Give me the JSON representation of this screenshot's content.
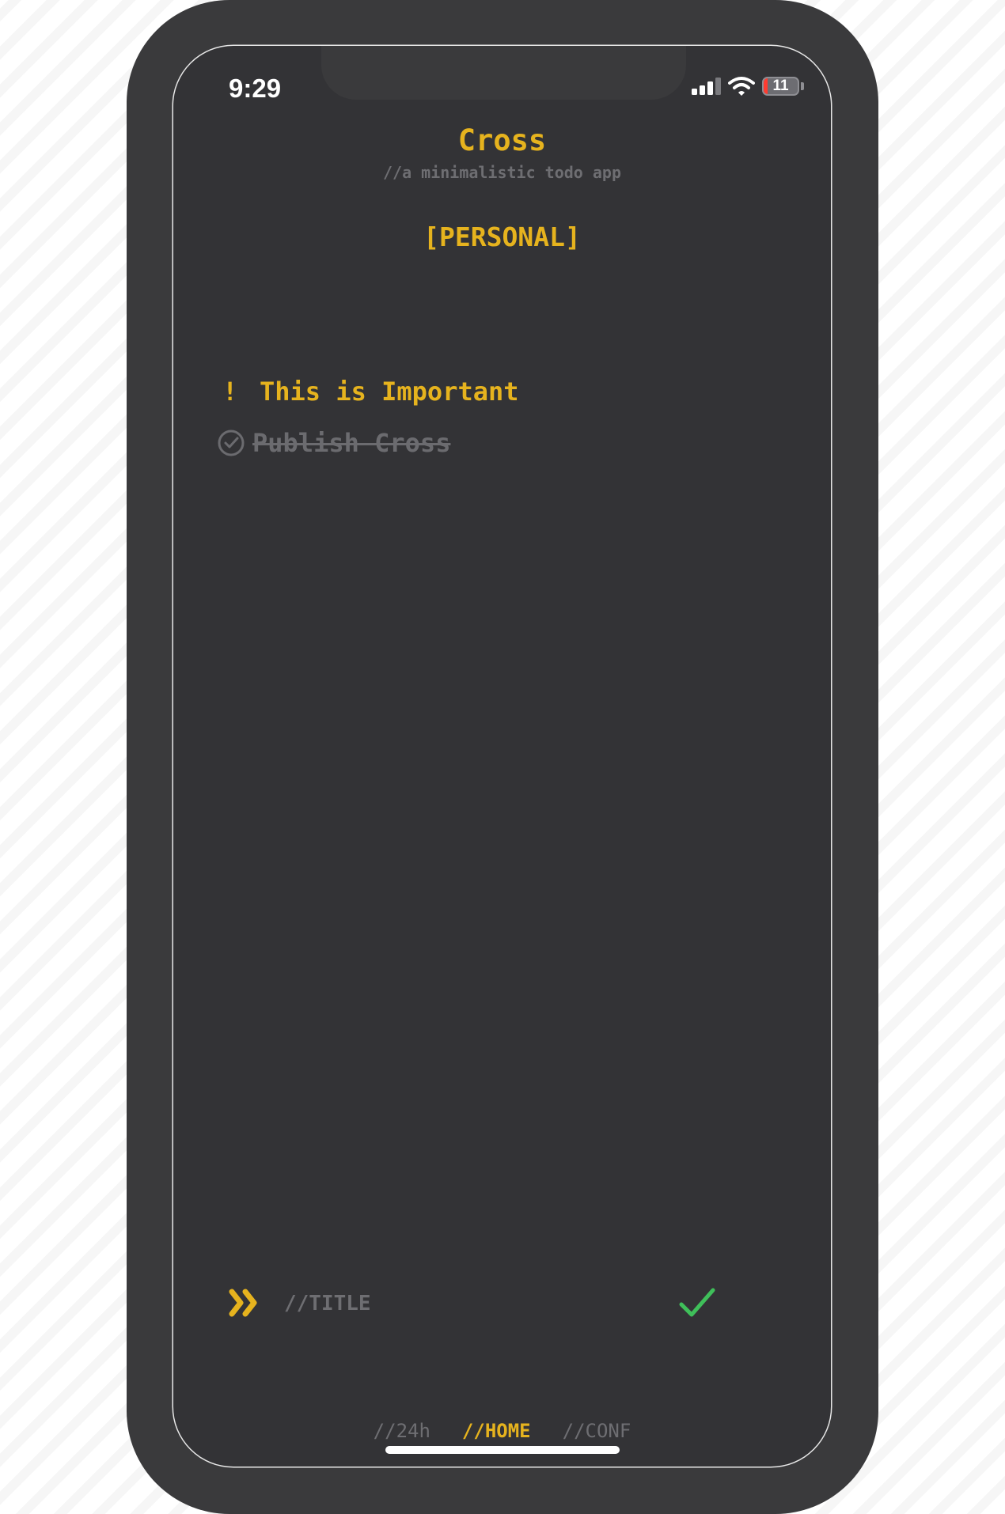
{
  "status_bar": {
    "time": "9:29",
    "battery": "11",
    "battery_level": 0.11,
    "signal_bars_active": 3,
    "signal_bars_total": 4
  },
  "header": {
    "title": "Cross",
    "subtitle": "//a minimalistic todo app"
  },
  "list": {
    "name": "[PERSONAL]",
    "items": [
      {
        "marker": "!",
        "text": "This is Important",
        "important": true,
        "done": false
      },
      {
        "marker": "check-circle-icon",
        "text": "Publish Cross",
        "important": false,
        "done": true
      }
    ]
  },
  "input": {
    "placeholder": "//TITLE",
    "value": ""
  },
  "nav": {
    "tabs": [
      {
        "label": "//24h",
        "active": false
      },
      {
        "label": "//HOME",
        "active": true
      },
      {
        "label": "//CONF",
        "active": false
      }
    ]
  },
  "colors": {
    "accent": "#e6b31e",
    "background": "#333336",
    "muted": "#6e6e72",
    "success": "#3fbf5a"
  }
}
